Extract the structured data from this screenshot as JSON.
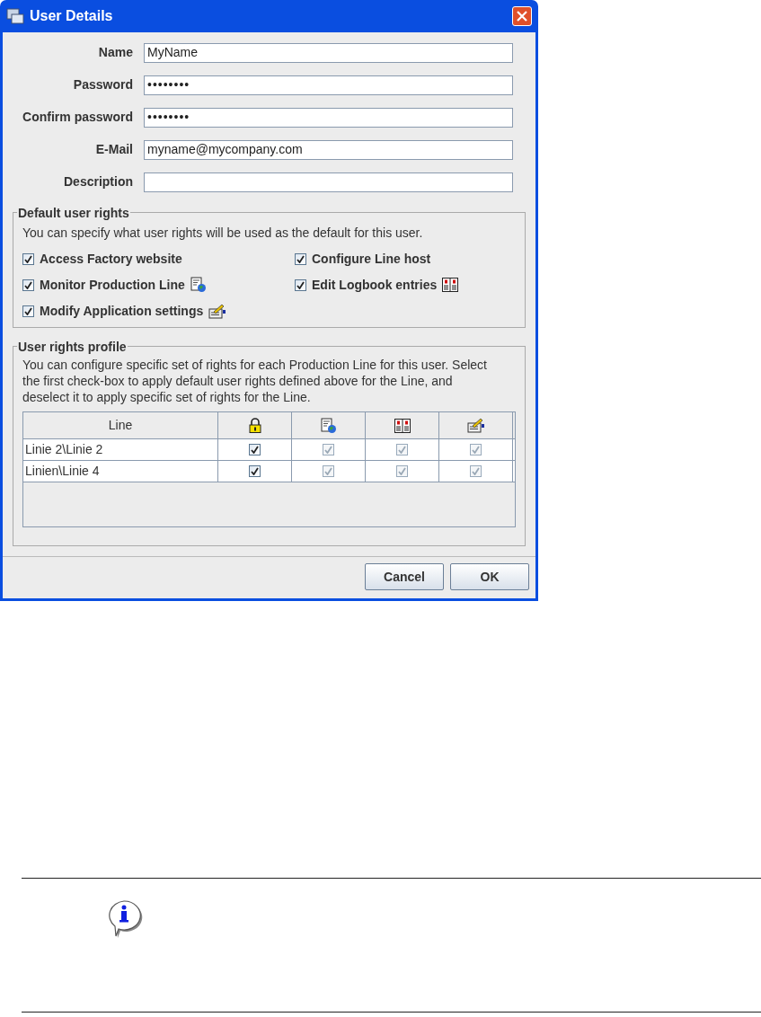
{
  "window": {
    "title": "User Details"
  },
  "fields": [
    {
      "label": "Name",
      "value": "MyName",
      "kind": "text"
    },
    {
      "label": "Password",
      "value": "••••••••",
      "kind": "password"
    },
    {
      "label": "Confirm password",
      "value": "••••••••",
      "kind": "password"
    },
    {
      "label": "E-Mail",
      "value": "myname@mycompany.com",
      "kind": "text"
    },
    {
      "label": "Description",
      "kind": "text"
    }
  ],
  "default_rights": {
    "title": "Default user rights",
    "description": "You can specify what user rights will be used as the default for this user.",
    "items": [
      {
        "label": "Access Factory website",
        "checked": true
      },
      {
        "label": "Configure Line host",
        "checked": true
      },
      {
        "label": "Monitor Production Line",
        "checked": true
      },
      {
        "label": "Edit Logbook entries",
        "checked": true
      },
      {
        "label": "Modify Application settings",
        "checked": true
      }
    ]
  },
  "rights_profile": {
    "title": "User rights profile",
    "description": "You can configure specific set of rights for each Production Line for this user. Select the first check-box to apply default user rights defined above for the Line, and deselect it to apply specific set of rights for the Line.",
    "table": {
      "columns": [
        {
          "label": "Line"
        }
      ],
      "rows": [
        {
          "line": "Linie 2\\Linie 2",
          "rights": [
            {
              "checked": true,
              "disabled": false
            },
            {
              "checked": true,
              "disabled": true
            },
            {
              "checked": true,
              "disabled": true
            },
            {
              "checked": true,
              "disabled": true
            }
          ]
        },
        {
          "line": "Linien\\Linie 4",
          "rights": [
            {
              "checked": true,
              "disabled": false
            },
            {
              "checked": true,
              "disabled": true
            },
            {
              "checked": true,
              "disabled": true
            },
            {
              "checked": true,
              "disabled": true
            }
          ]
        }
      ]
    }
  },
  "buttons": [
    {
      "label": "Cancel"
    },
    {
      "label": "OK"
    }
  ]
}
